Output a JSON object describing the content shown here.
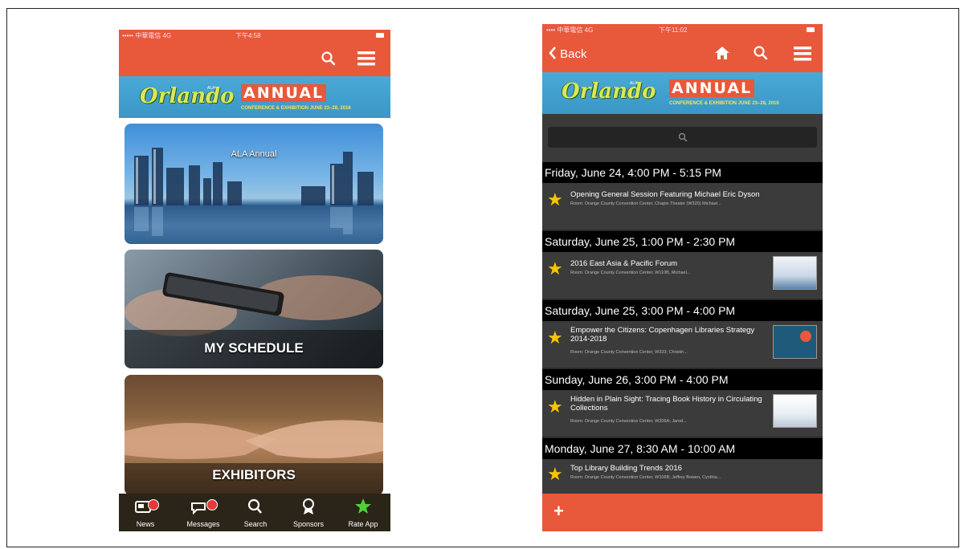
{
  "phone1": {
    "status": {
      "carrier": "••••• 中華電信 4G",
      "time": "下午4:58"
    },
    "banner": {
      "script": "Orlando",
      "ala": "ALA",
      "annual": "ANNUAL",
      "sub": "CONFERENCE & EXHIBITION JUNE 23–28, 2016"
    },
    "tiles": [
      {
        "title": "ALA Annual"
      },
      {
        "title": "MY SCHEDULE"
      },
      {
        "title": "EXHIBITORS"
      }
    ],
    "tabbar": [
      {
        "label": "News",
        "icon": "news-icon"
      },
      {
        "label": "Messages",
        "icon": "messages-icon"
      },
      {
        "label": "Search",
        "icon": "search-icon"
      },
      {
        "label": "Sponsors",
        "icon": "sponsors-icon"
      },
      {
        "label": "Rate App",
        "icon": "star-icon"
      }
    ],
    "colors": {
      "accent": "#e8583a",
      "tabbar": "#2b2418",
      "badge": "#e53a3a",
      "star": "#4cd137"
    }
  },
  "phone2": {
    "status": {
      "carrier": "•••• 中華電信 4G",
      "time": "下午11:02"
    },
    "nav": {
      "back_label": "Back"
    },
    "banner": {
      "script": "Orlando",
      "ala": "ALA",
      "annual": "ANNUAL",
      "sub": "CONFERENCE & EXHIBITION JUNE 23–28, 2016"
    },
    "schedule": [
      {
        "day": "Friday, June 24, 4:00 PM - 5:15 PM",
        "title": "Opening General Session Featuring Michael Eric Dyson",
        "room": "Room: Orange County Convention Center, Chapin Theater (W320) Michael..."
      },
      {
        "day": "Saturday, June 25, 1:00 PM - 2:30 PM",
        "title": "2016 East Asia & Pacific Forum",
        "room": "Room: Orange County Convention Center, W110B, Michael..."
      },
      {
        "day": "Saturday, June 25, 3:00 PM - 4:00 PM",
        "title": "Empower the Citizens: Copenhagen Libraries Strategy 2014-2018",
        "room": "Room: Orange County Convention Center, W333; Christin..."
      },
      {
        "day": "Sunday, June 26, 3:00 PM - 4:00 PM",
        "title": "Hidden in Plain Sight: Tracing Book History in Circulating Collections",
        "room": "Room: Orange County Convention Center, W206A; Jarod..."
      },
      {
        "day": "Monday, June 27, 8:30 AM - 10:00 AM",
        "title": "Top Library Building Trends 2016",
        "room": "Room: Orange County Convention Center, W106B; Jeffrey Bowen, Cynthia..."
      }
    ],
    "footer": {
      "add_icon": "plus-icon"
    },
    "colors": {
      "accent": "#e8583a",
      "day_header": "#000000",
      "event_bg": "#3b3b3b",
      "star": "#f7c600"
    }
  }
}
